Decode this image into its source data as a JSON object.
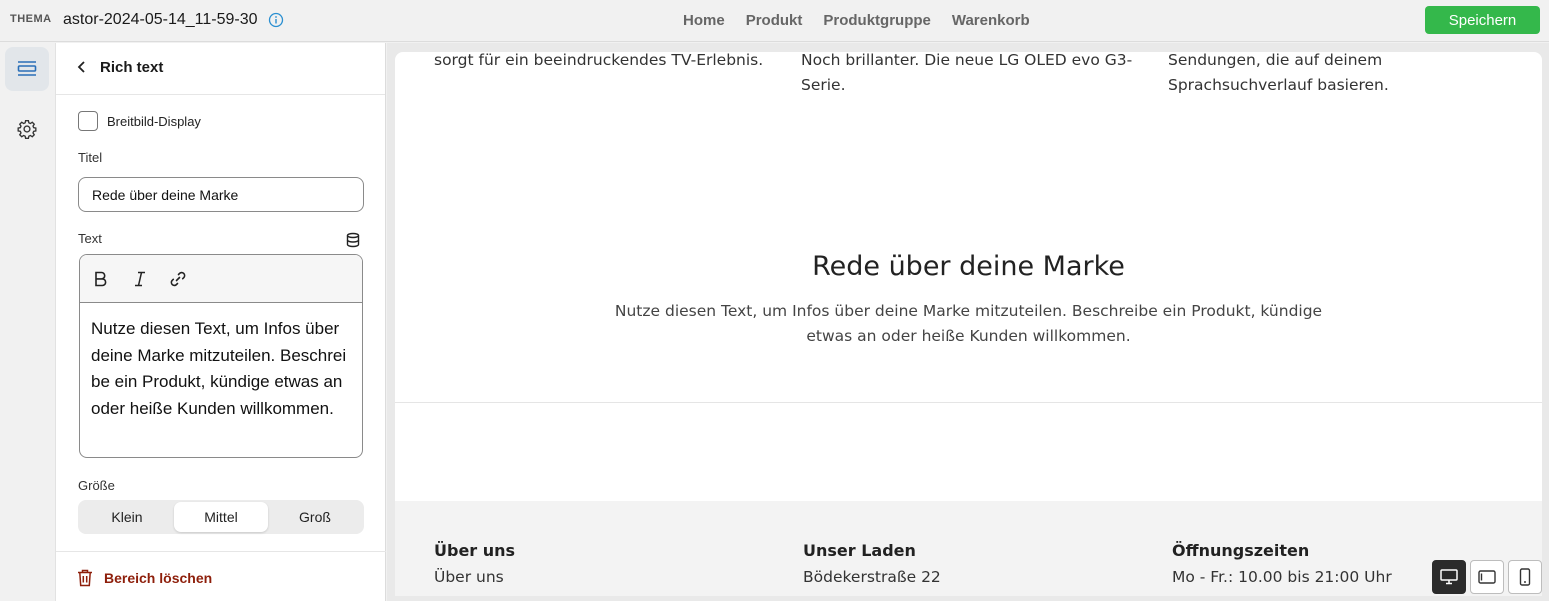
{
  "topbar": {
    "theme_label": "THEMA",
    "theme_name": "astor-2024-05-14_11-59-30",
    "nav": [
      "Home",
      "Produkt",
      "Produktgruppe",
      "Warenkorb"
    ],
    "save_label": "Speichern",
    "accent": "#34b84b"
  },
  "rail": {
    "items": [
      {
        "icon": "sections-icon",
        "active": true
      },
      {
        "icon": "gear-icon",
        "active": false
      }
    ]
  },
  "panel": {
    "title": "Rich text",
    "checkbox_label": "Breitbild-Display",
    "checkbox_checked": false,
    "title_label": "Titel",
    "title_value": "Rede über deine Marke",
    "text_label": "Text",
    "text_value": "Nutze diesen Text, um Infos über deine Marke mitzuteilen. Beschreibe ein Produkt, kündige etwas an oder heiße Kunden willkommen.",
    "size_label": "Größe",
    "size_options": [
      "Klein",
      "Mittel",
      "Groß"
    ],
    "size_selected": "Mittel",
    "delete_label": "Bereich löschen",
    "delete_color": "#8e1f0b"
  },
  "preview": {
    "columns": [
      {
        "lines": [
          "sorgt für ein beeindruckendes TV-Erlebnis."
        ]
      },
      {
        "lines": [
          "Noch brillanter. Die neue LG OLED evo G3-",
          "Serie."
        ]
      },
      {
        "lines": [
          "Sendungen, die auf deinem",
          "Sprachsuchverlauf basieren."
        ]
      }
    ],
    "heading": "Rede über deine Marke",
    "text": "Nutze diesen Text, um Infos über deine Marke mitzuteilen. Beschreibe ein Produkt, kündige etwas an oder heiße Kunden willkommen.",
    "footer": [
      {
        "head": "Über uns",
        "line": "Über uns"
      },
      {
        "head": "Unser Laden",
        "line": "Bödekerstraße 22"
      },
      {
        "head": "Öffnungszeiten",
        "line": "Mo - Fr.: 10.00 bis 21:00 Uhr"
      }
    ]
  },
  "devices": [
    "desktop-icon",
    "tablet-icon",
    "mobile-icon"
  ]
}
